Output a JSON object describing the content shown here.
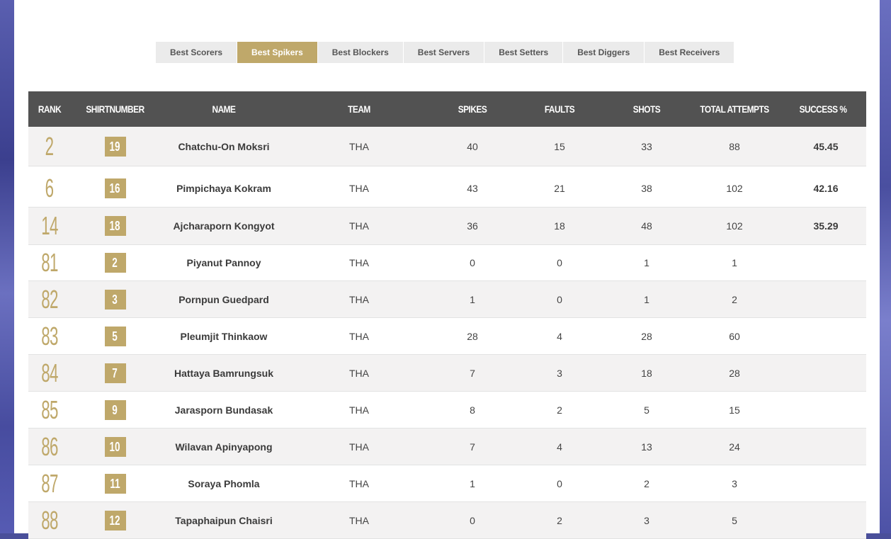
{
  "tabs": [
    {
      "label": "Best Scorers",
      "active": false
    },
    {
      "label": "Best Spikers",
      "active": true
    },
    {
      "label": "Best Blockers",
      "active": false
    },
    {
      "label": "Best Servers",
      "active": false
    },
    {
      "label": "Best Setters",
      "active": false
    },
    {
      "label": "Best Diggers",
      "active": false
    },
    {
      "label": "Best Receivers",
      "active": false
    }
  ],
  "table": {
    "headers": {
      "rank": "RANK",
      "shirt": "SHIRTNUMBER",
      "name": "NAME",
      "team": "TEAM",
      "spikes": "SPIKES",
      "faults": "FAULTS",
      "shots": "SHOTS",
      "total": "TOTAL ATTEMPTS",
      "success": "SUCCESS %"
    },
    "rows": [
      {
        "rank": "2",
        "shirt": "19",
        "name": "Chatchu-On Moksri",
        "team": "THA",
        "spikes": "40",
        "faults": "15",
        "shots": "33",
        "total": "88",
        "success": "45.45"
      },
      {
        "rank": "6",
        "shirt": "16",
        "name": "Pimpichaya Kokram",
        "team": "THA",
        "spikes": "43",
        "faults": "21",
        "shots": "38",
        "total": "102",
        "success": "42.16"
      },
      {
        "rank": "14",
        "shirt": "18",
        "name": "Ajcharaporn Kongyot",
        "team": "THA",
        "spikes": "36",
        "faults": "18",
        "shots": "48",
        "total": "102",
        "success": "35.29"
      },
      {
        "rank": "81",
        "shirt": "2",
        "name": "Piyanut Pannoy",
        "team": "THA",
        "spikes": "0",
        "faults": "0",
        "shots": "1",
        "total": "1",
        "success": ""
      },
      {
        "rank": "82",
        "shirt": "3",
        "name": "Pornpun Guedpard",
        "team": "THA",
        "spikes": "1",
        "faults": "0",
        "shots": "1",
        "total": "2",
        "success": ""
      },
      {
        "rank": "83",
        "shirt": "5",
        "name": "Pleumjit Thinkaow",
        "team": "THA",
        "spikes": "28",
        "faults": "4",
        "shots": "28",
        "total": "60",
        "success": ""
      },
      {
        "rank": "84",
        "shirt": "7",
        "name": "Hattaya Bamrungsuk",
        "team": "THA",
        "spikes": "7",
        "faults": "3",
        "shots": "18",
        "total": "28",
        "success": ""
      },
      {
        "rank": "85",
        "shirt": "9",
        "name": "Jarasporn Bundasak",
        "team": "THA",
        "spikes": "8",
        "faults": "2",
        "shots": "5",
        "total": "15",
        "success": ""
      },
      {
        "rank": "86",
        "shirt": "10",
        "name": "Wilavan Apinyapong",
        "team": "THA",
        "spikes": "7",
        "faults": "4",
        "shots": "13",
        "total": "24",
        "success": ""
      },
      {
        "rank": "87",
        "shirt": "11",
        "name": "Soraya Phomla",
        "team": "THA",
        "spikes": "1",
        "faults": "0",
        "shots": "2",
        "total": "3",
        "success": ""
      },
      {
        "rank": "88",
        "shirt": "12",
        "name": "Tapaphaipun Chaisri",
        "team": "THA",
        "spikes": "0",
        "faults": "2",
        "shots": "3",
        "total": "5",
        "success": ""
      }
    ]
  },
  "colors": {
    "accent_gold": "#bfa86a",
    "header_bg": "#525252",
    "page_bg": "#4a4f9a"
  }
}
